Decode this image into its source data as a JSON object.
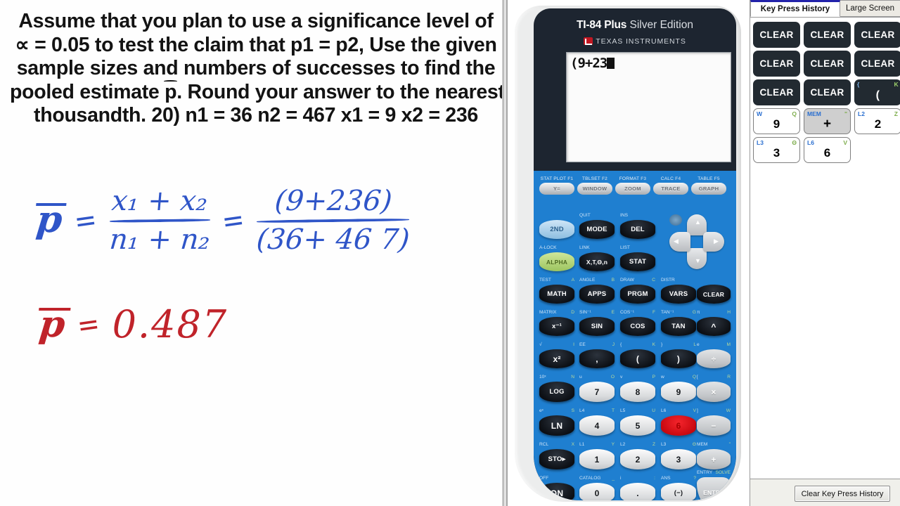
{
  "problem": {
    "lines": [
      "Assume that you plan to use a significance level of",
      "= 0.05 to test the claim that p1 = p2, Use the given",
      "sample sizes and numbers of successes to find the",
      "pooled estimate . Round your answer to the nearest",
      "thousandth. 20) n1 = 36  n2 = 467  x1 = 9  x2 = 236"
    ],
    "alpha_symbol": "∝",
    "phat_symbol": "p",
    "line2_rest": "= 0.05 to test the claim that p1 = p2, Use the given",
    "line4_pre": "pooled estimate ",
    "line4_post": ". Round your answer to the nearest",
    "given": {
      "n1": "36",
      "n2": "467",
      "x1": "9",
      "x2": "236",
      "alpha": "0.05"
    }
  },
  "handwriting": {
    "work_label": "p",
    "equals1": "=",
    "numerator1": "x₁ + x₂",
    "denominator1": "n₁ + n₂",
    "equals2": "=",
    "numerator2": "(9+236)",
    "denominator2": "(36+ 46 7)",
    "answer_label": "p",
    "answer_equals": "=",
    "answer_value": "0.487",
    "blue": "#2f55c8",
    "red": "#c0232a"
  },
  "calculator": {
    "brand_bold": "TI-84 Plus",
    "brand_light": " Silver Edition",
    "maker": "TEXAS INSTRUMENTS",
    "screen_text": "(9+23",
    "screen_cursor": true,
    "function_keys": [
      {
        "second": "STAT PLOT",
        "fkey": "F1",
        "label": "Y="
      },
      {
        "second": "TBLSET",
        "fkey": "F2",
        "label": "WINDOW"
      },
      {
        "second": "FORMAT",
        "fkey": "F3",
        "label": "ZOOM"
      },
      {
        "second": "CALC",
        "fkey": "F4",
        "label": "TRACE"
      },
      {
        "second": "TABLE",
        "fkey": "F5",
        "label": "GRAPH"
      }
    ],
    "keys": [
      {
        "label": "2ND",
        "style": "blue",
        "second": "",
        "alpha": ""
      },
      {
        "label": "MODE",
        "style": "dark",
        "second": "QUIT",
        "alpha": ""
      },
      {
        "label": "DEL",
        "style": "dark",
        "second": "INS",
        "alpha": ""
      },
      {
        "label": "ALPHA",
        "style": "green",
        "second": "A-LOCK",
        "alpha": ""
      },
      {
        "label": "X,T,Θ,n",
        "style": "dark",
        "second": "LINK",
        "alpha": ""
      },
      {
        "label": "STAT",
        "style": "dark",
        "second": "LIST",
        "alpha": ""
      },
      {
        "label": "MATH",
        "style": "dark",
        "second": "TEST",
        "alpha": "A"
      },
      {
        "label": "APPS",
        "style": "dark",
        "second": "ANGLE",
        "alpha": "B"
      },
      {
        "label": "PRGM",
        "style": "dark",
        "second": "DRAW",
        "alpha": "C"
      },
      {
        "label": "VARS",
        "style": "dark",
        "second": "DISTR",
        "alpha": ""
      },
      {
        "label": "CLEAR",
        "style": "dark",
        "second": "",
        "alpha": ""
      },
      {
        "label": "x⁻¹",
        "style": "dark",
        "second": "MATRIX",
        "alpha": "D"
      },
      {
        "label": "SIN",
        "style": "dark",
        "second": "SIN⁻¹",
        "alpha": "E"
      },
      {
        "label": "COS",
        "style": "dark",
        "second": "COS⁻¹",
        "alpha": "F"
      },
      {
        "label": "TAN",
        "style": "dark",
        "second": "TAN⁻¹",
        "alpha": "G"
      },
      {
        "label": "^",
        "style": "dark",
        "second": "π",
        "alpha": "H"
      },
      {
        "label": "x²",
        "style": "dark",
        "second": "√",
        "alpha": "I"
      },
      {
        "label": ",",
        "style": "dark",
        "second": "EE",
        "alpha": "J"
      },
      {
        "label": "(",
        "style": "dark",
        "second": "{",
        "alpha": "K"
      },
      {
        "label": ")",
        "style": "dark",
        "second": "}",
        "alpha": "L"
      },
      {
        "label": "÷",
        "style": "gray",
        "second": "e",
        "alpha": "M"
      },
      {
        "label": "LOG",
        "style": "dark",
        "second": "10ˣ",
        "alpha": "N"
      },
      {
        "label": "7",
        "style": "white",
        "second": "u",
        "alpha": "O"
      },
      {
        "label": "8",
        "style": "white",
        "second": "v",
        "alpha": "P"
      },
      {
        "label": "9",
        "style": "white",
        "second": "w",
        "alpha": "Q"
      },
      {
        "label": "×",
        "style": "gray",
        "second": "[",
        "alpha": "R"
      },
      {
        "label": "LN",
        "style": "dark",
        "second": "eˣ",
        "alpha": "S"
      },
      {
        "label": "4",
        "style": "white",
        "second": "L4",
        "alpha": "T"
      },
      {
        "label": "5",
        "style": "white",
        "second": "L5",
        "alpha": "U"
      },
      {
        "label": "6",
        "style": "red",
        "second": "L6",
        "alpha": "V"
      },
      {
        "label": "−",
        "style": "gray",
        "second": "]",
        "alpha": "W"
      },
      {
        "label": "STO▸",
        "style": "dark",
        "second": "RCL",
        "alpha": "X"
      },
      {
        "label": "1",
        "style": "white",
        "second": "L1",
        "alpha": "Y"
      },
      {
        "label": "2",
        "style": "white",
        "second": "L2",
        "alpha": "Z"
      },
      {
        "label": "3",
        "style": "white",
        "second": "L3",
        "alpha": "Θ"
      },
      {
        "label": "+",
        "style": "gray",
        "second": "MEM",
        "alpha": "\""
      },
      {
        "label": "ON",
        "style": "dark",
        "second": "OFF",
        "alpha": ""
      },
      {
        "label": "0",
        "style": "white",
        "second": "CATALOG",
        "alpha": "_"
      },
      {
        "label": ".",
        "style": "white",
        "second": "i",
        "alpha": ":"
      },
      {
        "label": "(−)",
        "style": "white",
        "second": "ANS",
        "alpha": "?"
      },
      {
        "label": "ENTER",
        "style": "enter",
        "second": "ENTRY",
        "alpha": "SOLVE"
      }
    ],
    "pressed_key": "6"
  },
  "right_panel": {
    "tabs": [
      {
        "label": "Key Press History",
        "active": true
      },
      {
        "label": "Large Screen",
        "active": false
      }
    ],
    "clear_button": "Clear Key Press History",
    "history": [
      {
        "label": "CLEAR",
        "style": "dark",
        "tl": "",
        "tr": ""
      },
      {
        "label": "CLEAR",
        "style": "dark",
        "tl": "",
        "tr": ""
      },
      {
        "label": "CLEAR",
        "style": "dark",
        "tl": "",
        "tr": ""
      },
      {
        "label": "CLEAR",
        "style": "dark",
        "tl": "",
        "tr": ""
      },
      {
        "label": "CLEAR",
        "style": "dark",
        "tl": "",
        "tr": ""
      },
      {
        "label": "CLEAR",
        "style": "dark",
        "tl": "",
        "tr": ""
      },
      {
        "label": "CLEAR",
        "style": "dark",
        "tl": "",
        "tr": ""
      },
      {
        "label": "CLEAR",
        "style": "dark",
        "tl": "",
        "tr": ""
      },
      {
        "label": "(",
        "style": "dark-paren",
        "tl": "{",
        "tr": "K"
      },
      {
        "label": "9",
        "style": "white",
        "tl": "W",
        "tr": "Q"
      },
      {
        "label": "+",
        "style": "gray",
        "tl": "MEM",
        "tr": "\""
      },
      {
        "label": "2",
        "style": "white",
        "tl": "L2",
        "tr": "Z"
      },
      {
        "label": "3",
        "style": "white",
        "tl": "L3",
        "tr": "Θ"
      },
      {
        "label": "6",
        "style": "white",
        "tl": "L6",
        "tr": "V"
      }
    ]
  }
}
